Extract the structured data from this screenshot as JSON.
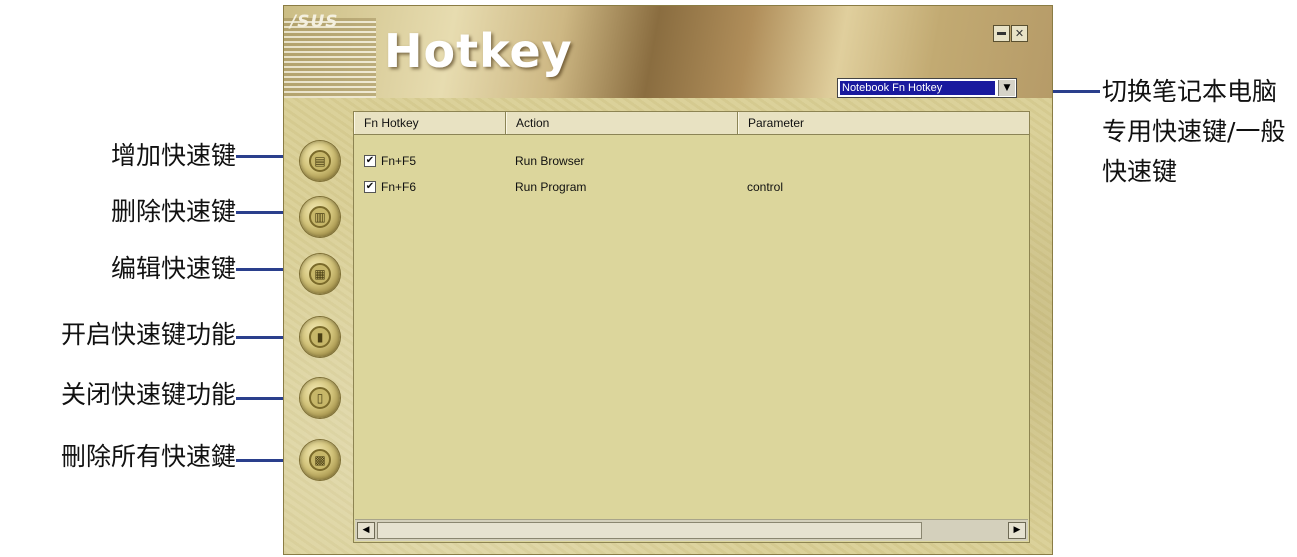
{
  "callouts": {
    "left": [
      "增加快速键",
      "删除快速键",
      "编辑快速键",
      "开启快速键功能",
      "关闭快速键功能",
      "刪除所有快速鍵"
    ],
    "right": "切换笔记本电脑专用快速键/一般快速键"
  },
  "window": {
    "brand": "/SUS",
    "title": "Hotkey",
    "mode_select": {
      "value": "Notebook Fn Hotkey"
    }
  },
  "list": {
    "columns": [
      "Fn Hotkey",
      "Action",
      "Parameter"
    ],
    "rows": [
      {
        "checked": "✔",
        "key": "Fn+F5",
        "action": "Run Browser",
        "parameter": ""
      },
      {
        "checked": "✔",
        "key": "Fn+F6",
        "action": "Run Program",
        "parameter": "control"
      }
    ]
  },
  "icons": {
    "side_buttons": [
      "add-hotkey-icon",
      "delete-hotkey-icon",
      "edit-hotkey-icon",
      "enable-hotkey-icon",
      "disable-hotkey-icon",
      "delete-all-hotkeys-icon"
    ],
    "minimize": "minimize-icon",
    "close": "close-icon",
    "dropdown": "chevron-down-icon",
    "scroll_left": "scroll-left-icon",
    "scroll_right": "scroll-right-icon"
  },
  "colors": {
    "leader_line": "#2a3f8c",
    "window_bg": "#d9cf95",
    "list_bg": "#dcd69c",
    "select_highlight": "#1a1a9e"
  }
}
